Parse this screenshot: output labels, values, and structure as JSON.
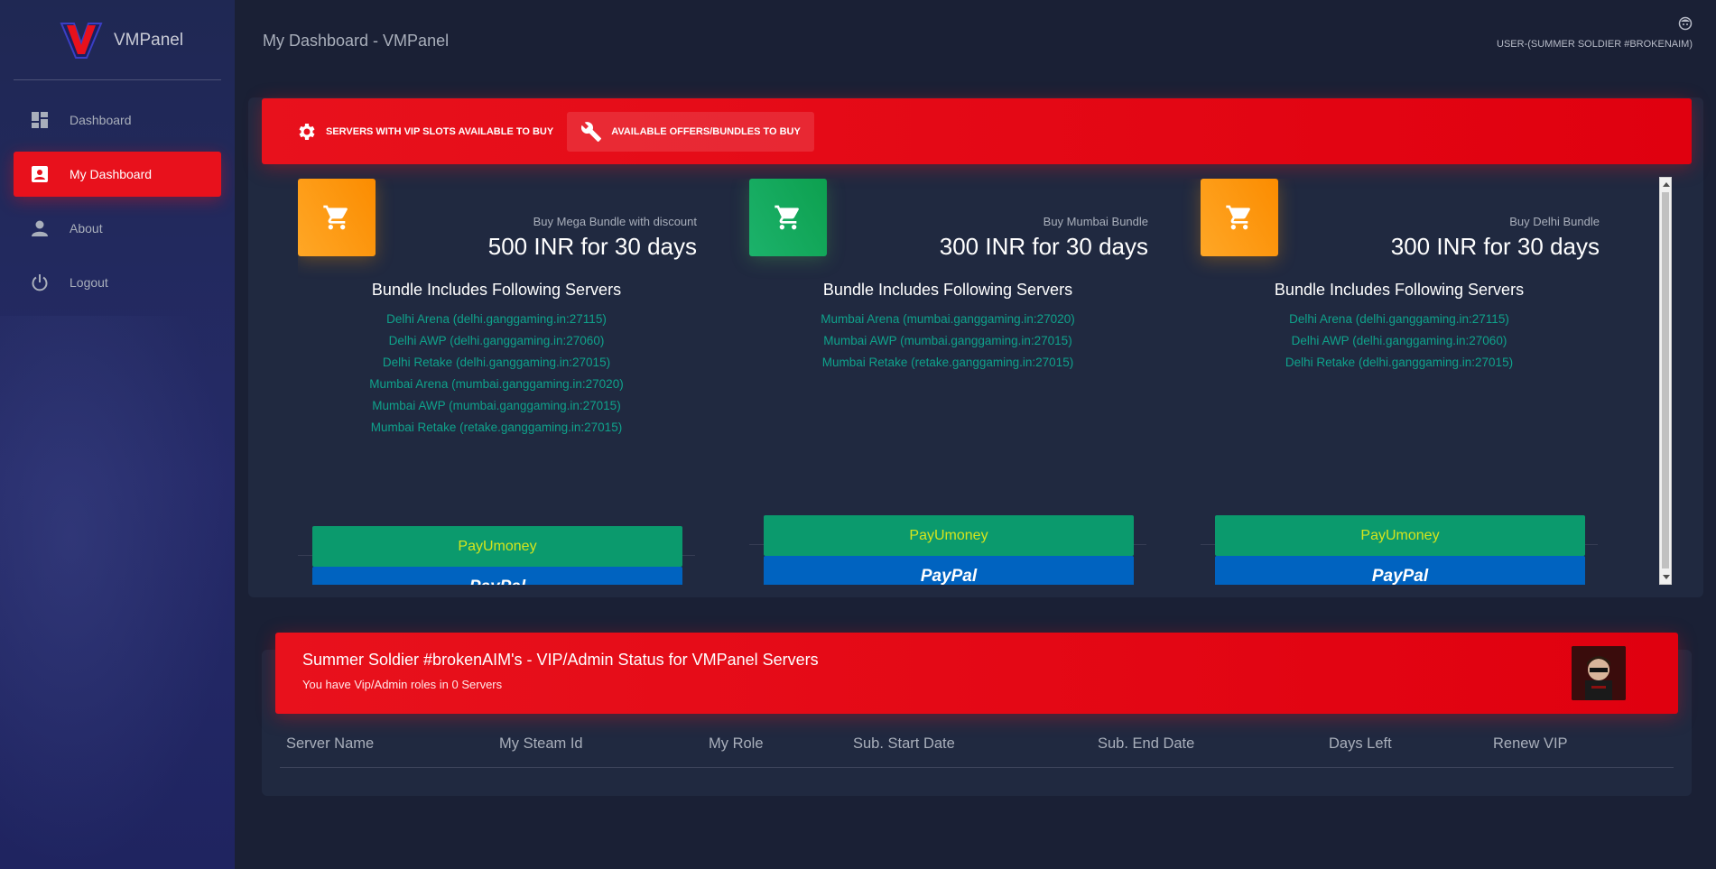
{
  "brand": {
    "name": "VMPanel",
    "accent": "#e8111c"
  },
  "sidebar": {
    "items": [
      {
        "label": "Dashboard",
        "icon": "dashboard-icon",
        "active": false
      },
      {
        "label": "My Dashboard",
        "icon": "account-box-icon",
        "active": true
      },
      {
        "label": "About",
        "icon": "person-icon",
        "active": false
      },
      {
        "label": "Logout",
        "icon": "power-icon",
        "active": false
      }
    ]
  },
  "header": {
    "title": "My Dashboard - VMPanel",
    "user_label": "USER-(SUMMER SOLDIER #BROKENAIM)"
  },
  "bundles_card": {
    "tabs": [
      {
        "label": "SERVERS WITH VIP SLOTS AVAILABLE TO BUY",
        "icon": "gear-icon",
        "selected": false
      },
      {
        "label": "AVAILABLE OFFERS/BUNDLES TO BUY",
        "icon": "wrench-icon",
        "selected": true
      }
    ],
    "bundles": [
      {
        "subtitle": "Buy Mega Bundle with discount",
        "price": "500 INR for 30 days",
        "includes_label": "Bundle Includes Following Servers",
        "servers": [
          "Delhi Arena (delhi.ganggaming.in:27115)",
          "Delhi AWP (delhi.ganggaming.in:27060)",
          "Delhi Retake (delhi.ganggaming.in:27015)",
          "Mumbai Arena (mumbai.ganggaming.in:27020)",
          "Mumbai AWP (mumbai.ganggaming.in:27015)",
          "Mumbai Retake (retake.ganggaming.in:27015)"
        ],
        "paypal_label": "PayPal",
        "payu_label": "PayUmoney",
        "icon_color": "orange"
      },
      {
        "subtitle": "Buy Mumbai Bundle",
        "price": "300 INR for 30 days",
        "includes_label": "Bundle Includes Following Servers",
        "servers": [
          "Mumbai Arena (mumbai.ganggaming.in:27020)",
          "Mumbai AWP (mumbai.ganggaming.in:27015)",
          "Mumbai Retake (retake.ganggaming.in:27015)"
        ],
        "paypal_label": "PayPal",
        "payu_label": "PayUmoney",
        "icon_color": "green"
      },
      {
        "subtitle": "Buy Delhi Bundle",
        "price": "300 INR for 30 days",
        "includes_label": "Bundle Includes Following Servers",
        "servers": [
          "Delhi Arena (delhi.ganggaming.in:27115)",
          "Delhi AWP (delhi.ganggaming.in:27060)",
          "Delhi Retake (delhi.ganggaming.in:27015)"
        ],
        "paypal_label": "PayPal",
        "payu_label": "PayUmoney",
        "icon_color": "orange"
      }
    ]
  },
  "status_card": {
    "title": "Summer Soldier #brokenAIM's - VIP/Admin Status for VMPanel Servers",
    "subtitle": "You have Vip/Admin roles in 0 Servers",
    "columns": [
      "Server Name",
      "My Steam Id",
      "My Role",
      "Sub. Start Date",
      "Sub. End Date",
      "Days Left",
      "Renew VIP"
    ]
  }
}
